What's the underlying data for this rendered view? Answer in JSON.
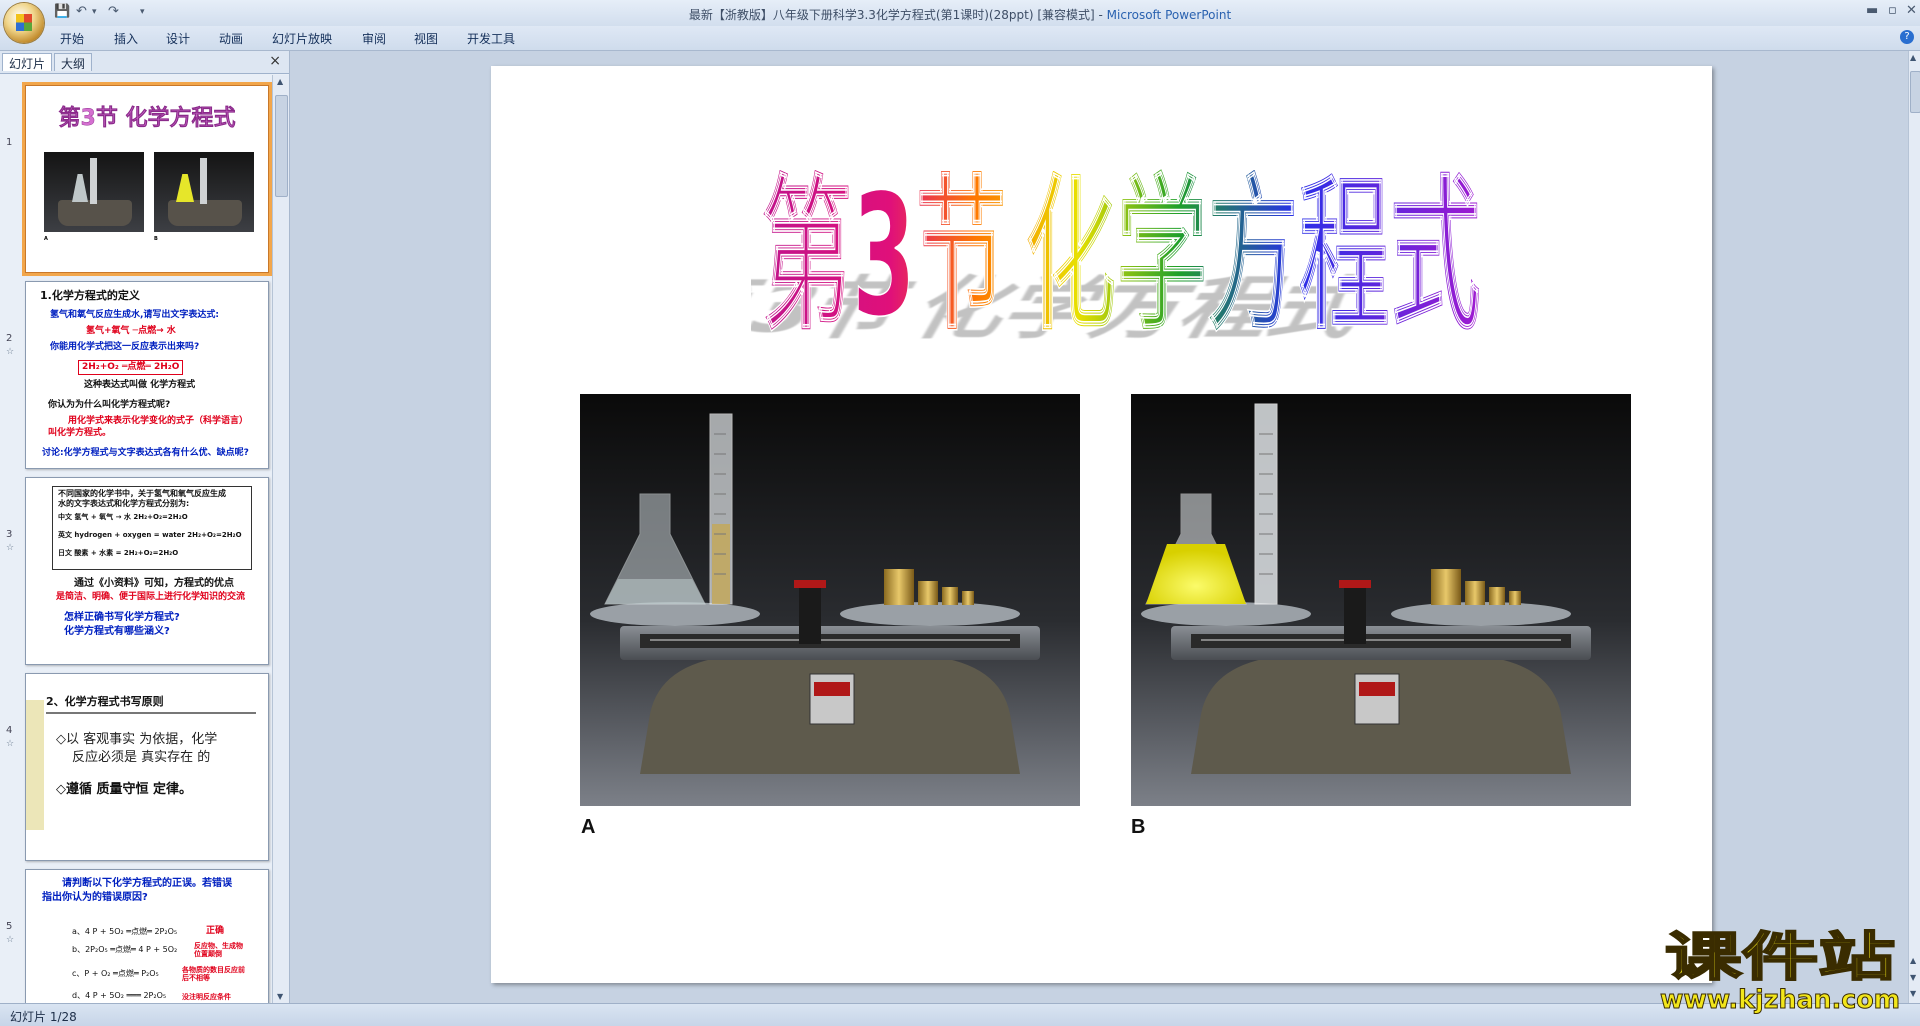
{
  "window": {
    "title_doc": "最新【浙教版】八年级下册科学3.3化学方程式(第1课时)(28ppt) [兼容模式]",
    "title_sep": " - ",
    "title_app": "Microsoft PowerPoint"
  },
  "ribbon": {
    "tabs": [
      "开始",
      "插入",
      "设计",
      "动画",
      "幻灯片放映",
      "审阅",
      "视图",
      "开发工具"
    ]
  },
  "left_pane": {
    "tab_slides": "幻灯片",
    "tab_outline": "大纲",
    "close": "×",
    "thumbnails": [
      {
        "num": "1",
        "title": "第3节  化学方程式",
        "photo_a": "A",
        "photo_b": "B"
      },
      {
        "num": "2",
        "lines": [
          "1.化学方程式的定义",
          "氢气和氧气反应生成水,请写出文字表达式:",
          "氢气+氧气 ─点燃→ 水",
          "你能用化学式把这一反应表示出来吗?",
          "2H₂+O₂ ═点燃═ 2H₂O",
          "这种表达式叫做 化学方程式",
          "你认为为什么叫化学方程式呢?",
          "用化学式来表示化学变化的式子（科学语言）",
          "叫化学方程式。",
          "讨论:化学方程式与文字表达式各有什么优、缺点呢?"
        ]
      },
      {
        "num": "3",
        "lines": [
          "不同国家的化学书中，关于氢气和氧气反应生成",
          "水的文字表达式和化学方程式分别为:",
          "中文   氢气 + 氧气 → 水            2H₂+O₂=2H₂O",
          "英文   hydrogen + oxygen = water    2H₂+O₂=2H₂O",
          "日文   酸素 + 水素 =               2H₂+O₂=2H₂O",
          "通过《小资料》可知，方程式的优点",
          "是简洁、明确、便于国际上进行化学知识的交流",
          "怎样正确书写化学方程式?",
          "化学方程式有哪些涵义?"
        ]
      },
      {
        "num": "4",
        "lines": [
          "2、化学方程式书写原则",
          "◇以 客观事实 为依据，化学",
          "反应必须是  真实存在 的",
          "◇遵循 质量守恒 定律。"
        ]
      },
      {
        "num": "5",
        "lines": [
          "请判断以下化学方程式的正误。若错误",
          "指出你认为的错误原因?",
          "a、4 P + 5O₂ ═点燃═ 2P₂O₅",
          "正确",
          "b、2P₂O₅ ═点燃═ 4 P + 5O₂",
          "反应物、生成物位置颠倒",
          "c、P + O₂ ═点燃═ P₂O₅",
          "各物质的数目反应前后不相等",
          "d、4 P + 5O₂ ═══ 2P₂O₅",
          "没注明反应条件"
        ]
      }
    ]
  },
  "slide": {
    "title_part1": "第3节",
    "title_part2": "化学方程式",
    "photo_a_label": "A",
    "photo_b_label": "B"
  },
  "status": {
    "slide_indicator": "幻灯片 1/28"
  },
  "watermark": {
    "text_cn": "课件站",
    "text_url": "www.kjzhan.com"
  },
  "colors": {
    "accent_selected": "#f2a64b",
    "title_magenta": "#c0148c",
    "title_orange": "#ff7a00",
    "title_yellow": "#e8e000",
    "title_green": "#1fa02a",
    "title_blue": "#2830e8",
    "title_violet": "#a01ad0"
  }
}
